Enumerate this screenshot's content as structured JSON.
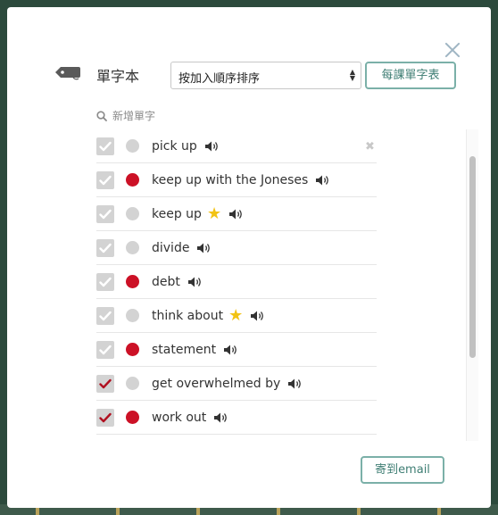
{
  "header": {
    "title": "單字本",
    "sort_value": "按加入順序排序",
    "lesson_button": "每課單字表"
  },
  "add_word_label": "新增單字",
  "colors": {
    "accent": "#3f7e74",
    "red_dot": "#cc1126",
    "grey_dot": "#d3d3d3",
    "star": "#f2c314",
    "check_red": "#b01020",
    "check_white": "#ffffff"
  },
  "words": [
    {
      "text": "pick up",
      "dot": "grey",
      "star": false,
      "checked_style": "white"
    },
    {
      "text": "keep up with the Joneses",
      "dot": "red",
      "star": false,
      "checked_style": "white"
    },
    {
      "text": "keep up",
      "dot": "grey",
      "star": true,
      "checked_style": "white"
    },
    {
      "text": "divide",
      "dot": "grey",
      "star": false,
      "checked_style": "white"
    },
    {
      "text": "debt",
      "dot": "red",
      "star": false,
      "checked_style": "white"
    },
    {
      "text": "think about",
      "dot": "grey",
      "star": true,
      "checked_style": "white"
    },
    {
      "text": "statement",
      "dot": "red",
      "star": false,
      "checked_style": "white"
    },
    {
      "text": "get overwhelmed by",
      "dot": "grey",
      "star": false,
      "checked_style": "red"
    },
    {
      "text": "work out",
      "dot": "red",
      "star": false,
      "checked_style": "red"
    }
  ],
  "email_button": "寄到email"
}
